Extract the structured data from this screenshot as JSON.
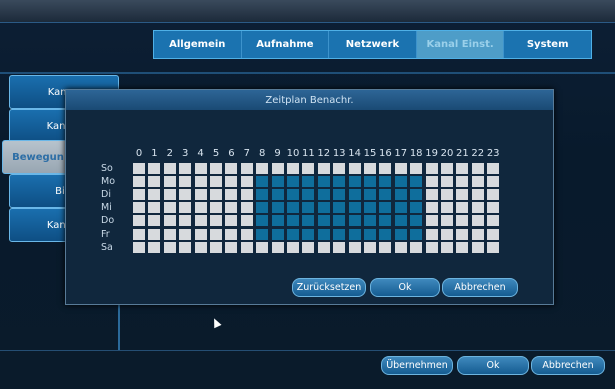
{
  "top_tabs": [
    "Allgemein",
    "Aufnahme",
    "Netzwerk",
    "Kanal Einst.",
    "System"
  ],
  "active_tab": "Kanal Einst.",
  "sidebar": [
    "Kamer",
    "Kanal-/",
    "Bewegun",
    "Bitr",
    "Kanal-I"
  ],
  "dialog": {
    "title": "Zeitplan Benachr.",
    "hours": [
      "0",
      "1",
      "2",
      "3",
      "4",
      "5",
      "6",
      "7",
      "8",
      "9",
      "10",
      "11",
      "12",
      "13",
      "14",
      "15",
      "16",
      "17",
      "18",
      "19",
      "20",
      "21",
      "22",
      "23"
    ],
    "days": [
      "So",
      "Mo",
      "Di",
      "Mi",
      "Do",
      "Fr",
      "Sa"
    ],
    "schedule_active": {
      "So": [],
      "Mo": [
        8,
        9,
        10,
        11,
        12,
        13,
        14,
        15,
        16,
        17,
        18
      ],
      "Di": [
        8,
        9,
        10,
        11,
        12,
        13,
        14,
        15,
        16,
        17,
        18
      ],
      "Mi": [
        8,
        9,
        10,
        11,
        12,
        13,
        14,
        15,
        16,
        17,
        18
      ],
      "Do": [
        8,
        9,
        10,
        11,
        12,
        13,
        14,
        15,
        16,
        17,
        18
      ],
      "Fr": [
        8,
        9,
        10,
        11,
        12,
        13,
        14,
        15,
        16,
        17,
        18
      ],
      "Sa": []
    },
    "reset_label": "Zurücksetzen",
    "ok_label": "Ok",
    "cancel_label": "Abbrechen"
  },
  "bottom": {
    "apply_label": "Übernehmen",
    "ok_label": "Ok",
    "cancel_label": "Abbrechen"
  }
}
